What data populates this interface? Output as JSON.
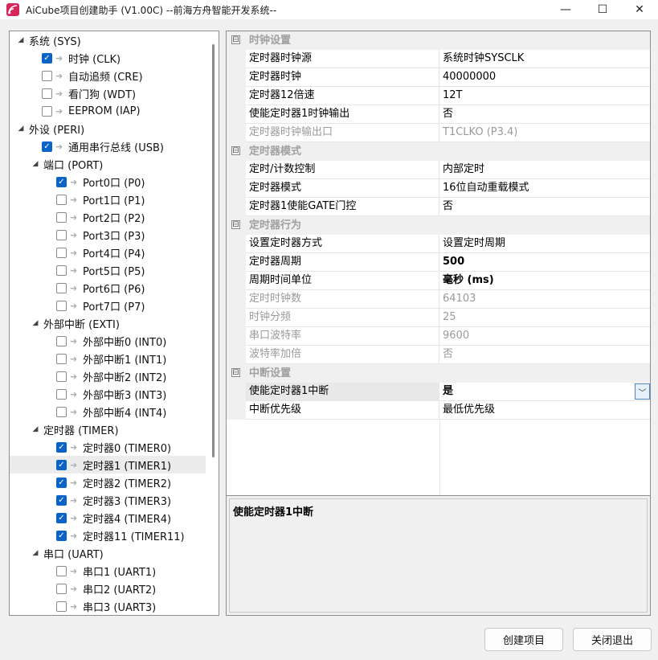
{
  "window": {
    "title": "AiCube项目创建助手 (V1.00C) --前海方舟智能开发系统--",
    "minimize": "—",
    "maximize": "☐",
    "close": "✕"
  },
  "tree": [
    {
      "label": "系统 (SYS)",
      "level": 0,
      "expander": "expanded"
    },
    {
      "label": "时钟 (CLK)",
      "level": 1,
      "checked": true
    },
    {
      "label": "自动追频 (CRE)",
      "level": 1,
      "checked": false
    },
    {
      "label": "看门狗 (WDT)",
      "level": 1,
      "checked": false
    },
    {
      "label": "EEPROM (IAP)",
      "level": 1,
      "checked": false
    },
    {
      "label": "外设 (PERI)",
      "level": 0,
      "expander": "expanded"
    },
    {
      "label": "通用串行总线 (USB)",
      "level": 1,
      "checked": true
    },
    {
      "label": "端口 (PORT)",
      "level": 1,
      "expander": "expanded"
    },
    {
      "label": "Port0口 (P0)",
      "level": 2,
      "checked": true
    },
    {
      "label": "Port1口 (P1)",
      "level": 2,
      "checked": false
    },
    {
      "label": "Port2口 (P2)",
      "level": 2,
      "checked": false
    },
    {
      "label": "Port3口 (P3)",
      "level": 2,
      "checked": false
    },
    {
      "label": "Port4口 (P4)",
      "level": 2,
      "checked": false
    },
    {
      "label": "Port5口 (P5)",
      "level": 2,
      "checked": false
    },
    {
      "label": "Port6口 (P6)",
      "level": 2,
      "checked": false
    },
    {
      "label": "Port7口 (P7)",
      "level": 2,
      "checked": false
    },
    {
      "label": "外部中断 (EXTI)",
      "level": 1,
      "expander": "expanded"
    },
    {
      "label": "外部中断0 (INT0)",
      "level": 2,
      "checked": false
    },
    {
      "label": "外部中断1 (INT1)",
      "level": 2,
      "checked": false
    },
    {
      "label": "外部中断2 (INT2)",
      "level": 2,
      "checked": false
    },
    {
      "label": "外部中断3 (INT3)",
      "level": 2,
      "checked": false
    },
    {
      "label": "外部中断4 (INT4)",
      "level": 2,
      "checked": false
    },
    {
      "label": "定时器 (TIMER)",
      "level": 1,
      "expander": "expanded"
    },
    {
      "label": "定时器0 (TIMER0)",
      "level": 2,
      "checked": true
    },
    {
      "label": "定时器1 (TIMER1)",
      "level": 2,
      "checked": true,
      "selected": true
    },
    {
      "label": "定时器2 (TIMER2)",
      "level": 2,
      "checked": true
    },
    {
      "label": "定时器3 (TIMER3)",
      "level": 2,
      "checked": true
    },
    {
      "label": "定时器4 (TIMER4)",
      "level": 2,
      "checked": true
    },
    {
      "label": "定时器11 (TIMER11)",
      "level": 2,
      "checked": true
    },
    {
      "label": "串口 (UART)",
      "level": 1,
      "expander": "expanded"
    },
    {
      "label": "串口1 (UART1)",
      "level": 2,
      "checked": false
    },
    {
      "label": "串口2 (UART2)",
      "level": 2,
      "checked": false
    },
    {
      "label": "串口3 (UART3)",
      "level": 2,
      "checked": false
    }
  ],
  "properties": [
    {
      "category": "时钟设置",
      "sign": "⊟"
    },
    {
      "name": "定时器时钟源",
      "value": "系统时钟SYSCLK"
    },
    {
      "name": "定时器时钟",
      "value": "40000000"
    },
    {
      "name": "定时器12倍速",
      "value": "12T"
    },
    {
      "name": "使能定时器1时钟输出",
      "value": "否"
    },
    {
      "name": "定时器时钟输出口",
      "value": "T1CLKO (P3.4)",
      "disabled": true
    },
    {
      "category": "定时器模式",
      "sign": "⊟"
    },
    {
      "name": "定时/计数控制",
      "value": "内部定时"
    },
    {
      "name": "定时器模式",
      "value": "16位自动重载模式"
    },
    {
      "name": "定时器1使能GATE门控",
      "value": "否"
    },
    {
      "category": "定时器行为",
      "sign": "⊟"
    },
    {
      "name": "设置定时器方式",
      "value": "设置定时周期"
    },
    {
      "name": "定时器周期",
      "value": "500",
      "bold": true
    },
    {
      "name": "周期时间单位",
      "value": "毫秒 (ms)",
      "bold": true
    },
    {
      "name": "定时时钟数",
      "value": "64103",
      "disabled": true
    },
    {
      "name": "时钟分频",
      "value": "25",
      "disabled": true
    },
    {
      "name": "串口波特率",
      "value": "9600",
      "disabled": true
    },
    {
      "name": "波特率加倍",
      "value": "否",
      "disabled": true
    },
    {
      "category": "中断设置",
      "sign": "⊟"
    },
    {
      "name": "使能定时器1中断",
      "value": "是",
      "bold": true,
      "selected": true,
      "dropdown": "﹀"
    },
    {
      "name": "中断优先级",
      "value": "最低优先级"
    }
  ],
  "description": {
    "text": "使能定时器1中断"
  },
  "buttons": {
    "create": "创建项目",
    "close": "关闭退出"
  },
  "colors": {
    "accent": "#0a64c8",
    "selection": "#ececec",
    "category_text": "#a0a0a0"
  }
}
